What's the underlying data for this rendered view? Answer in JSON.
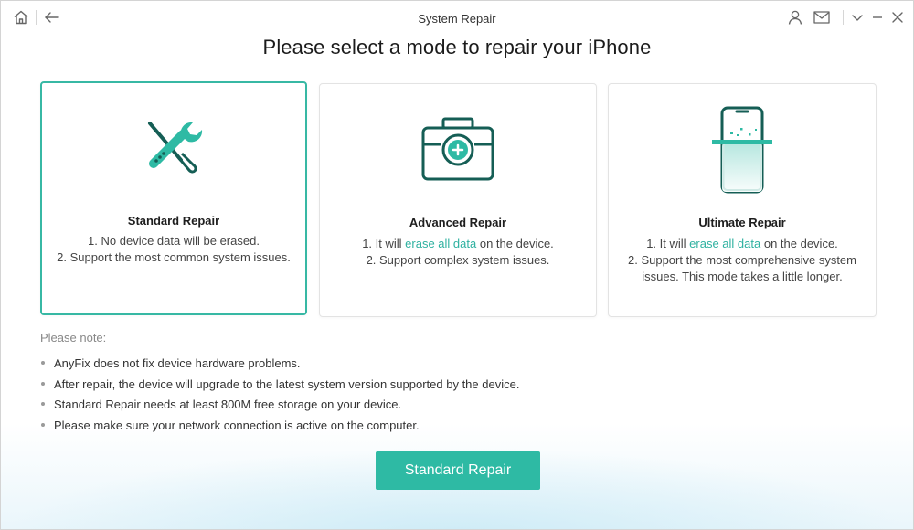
{
  "window": {
    "title": "System Repair",
    "headline": "Please select a mode to repair your iPhone"
  },
  "colors": {
    "accent": "#2ebaa4",
    "icon_dark": "#155e55",
    "link": "#2fb1a0"
  },
  "icons": {
    "home": "home-icon",
    "back": "back-arrow-icon",
    "user": "user-icon",
    "mail": "mail-icon",
    "menu": "chevron-down-icon",
    "minimize": "minimize-icon",
    "close": "close-icon"
  },
  "modes": [
    {
      "title": "Standard Repair",
      "icon": "wrench-screwdriver-icon",
      "selected": true,
      "line1": "1. No device data will be erased.",
      "line2": "2. Support the most common system issues."
    },
    {
      "title": "Advanced Repair",
      "icon": "medical-kit-icon",
      "selected": false,
      "line1_pre": "1. It will ",
      "line1_hl": "erase all data",
      "line1_post": " on the device.",
      "line2": "2. Support complex system issues."
    },
    {
      "title": "Ultimate Repair",
      "icon": "phone-scan-icon",
      "selected": false,
      "line1_pre": "1. It will ",
      "line1_hl": "erase all data",
      "line1_post": " on the device.",
      "line2a": "2. Support the most comprehensive system",
      "line2b": "issues. This mode takes a little longer."
    }
  ],
  "notes": {
    "title": "Please note:",
    "items": [
      "AnyFix does not fix device hardware problems.",
      "After repair, the device will upgrade to the latest system version supported by the device.",
      "Standard Repair needs at least 800M free storage on your device.",
      "Please make sure your network connection is active on the computer."
    ]
  },
  "action": {
    "button_label": "Standard Repair"
  }
}
